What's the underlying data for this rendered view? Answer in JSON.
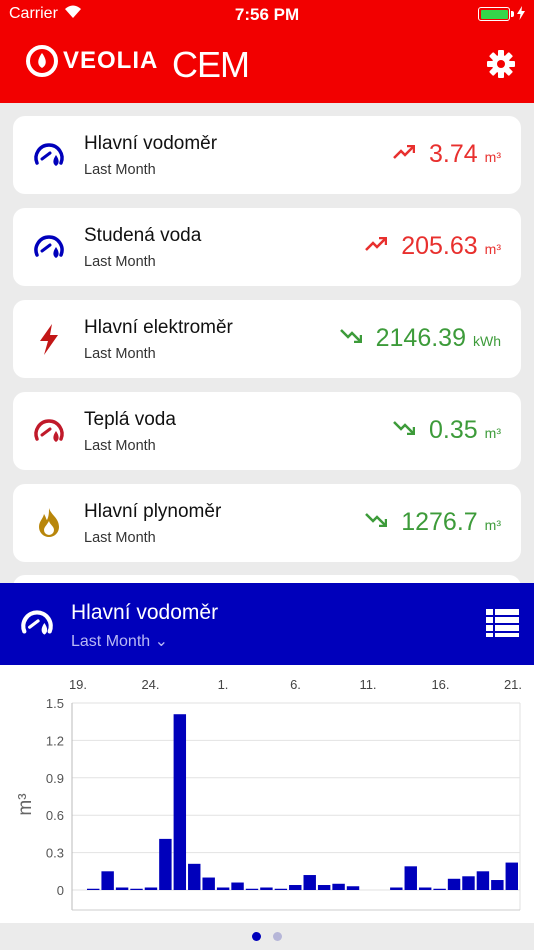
{
  "status": {
    "carrier": "Carrier",
    "time": "7:56 PM"
  },
  "header": {
    "brand": "VEOLIA",
    "app": "CEM"
  },
  "colors": {
    "brand_red": "#f20000",
    "panel_blue": "#0000bb",
    "up_red": "#e8302e",
    "down_green": "#3d9b3a"
  },
  "meters": [
    {
      "name": "Hlavní vodoměr",
      "period": "Last Month",
      "value": "3.74",
      "unit": "m³",
      "trend": "up",
      "icon": "water-meter-icon",
      "icon_color": "#0000bb"
    },
    {
      "name": "Studená voda",
      "period": "Last Month",
      "value": "205.63",
      "unit": "m³",
      "trend": "up",
      "icon": "water-meter-icon",
      "icon_color": "#0000bb"
    },
    {
      "name": "Hlavní elektroměr",
      "period": "Last Month",
      "value": "2146.39",
      "unit": "kWh",
      "trend": "down",
      "icon": "electricity-bolt-icon",
      "icon_color": "#c21616"
    },
    {
      "name": "Teplá voda",
      "period": "Last Month",
      "value": "0.35",
      "unit": "m³",
      "trend": "down",
      "icon": "water-meter-icon",
      "icon_color": "#c01a2a"
    },
    {
      "name": "Hlavní plynoměr",
      "period": "Last Month",
      "value": "1276.7",
      "unit": "m³",
      "trend": "down",
      "icon": "gas-flame-icon",
      "icon_color": "#b8860b"
    }
  ],
  "panel": {
    "title": "Hlavní vodoměr",
    "period": "Last Month"
  },
  "chart_data": {
    "type": "bar",
    "ylabel": "m³",
    "ylim": [
      0,
      1.5
    ],
    "yticks": [
      "0",
      "0.3",
      "0.6",
      "0.9",
      "1.2",
      "1.5"
    ],
    "xticks": [
      "19.",
      "24.",
      "1.",
      "6.",
      "11.",
      "16.",
      "21."
    ],
    "bar_color": "#0000bb",
    "values": [
      0.01,
      0.15,
      0.02,
      0.01,
      0.02,
      0.41,
      1.41,
      0.21,
      0.1,
      0.02,
      0.06,
      0.01,
      0.02,
      0.01,
      0.04,
      0.12,
      0.04,
      0.05,
      0.03,
      0.0,
      0.0,
      0.02,
      0.19,
      0.02,
      0.01,
      0.09,
      0.11,
      0.15,
      0.08,
      0.22
    ]
  }
}
